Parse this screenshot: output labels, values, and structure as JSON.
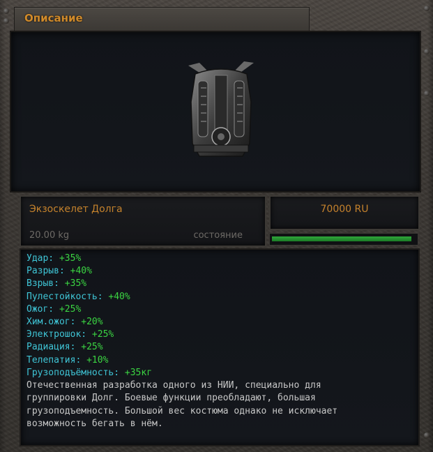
{
  "window": {
    "title": "Описание"
  },
  "item": {
    "image_icon": "exoskeleton-armor-icon",
    "name": "Экзоскелет Долга",
    "weight": "20.00 kg",
    "condition_label": "состояние",
    "price": "70000 RU",
    "condition_fraction": 0.98
  },
  "stats": [
    {
      "label": "Удар:",
      "value": "+35%"
    },
    {
      "label": "Разрыв:",
      "value": "+40%"
    },
    {
      "label": "Взрыв:",
      "value": "+35%"
    },
    {
      "label": "Пулестойкость:",
      "value": "+40%"
    },
    {
      "label": "Ожог:",
      "value": "+25%"
    },
    {
      "label": "Хим.ожог:",
      "value": "+20%"
    },
    {
      "label": "Электрошок:",
      "value": "+25%"
    },
    {
      "label": "Радиация:",
      "value": "+25%"
    },
    {
      "label": "Телепатия:",
      "value": "+10%"
    },
    {
      "label": "Грузоподъёмность:",
      "value": "+35кг"
    }
  ],
  "description_lines": [
    " Отечественная разработка одного из НИИ, специально для",
    "группировки Долг. Боевые функции преобладают, большая",
    "грузоподъемность. Большой вес костюма однако не исключает",
    "возможность бегать в нём."
  ],
  "colors": {
    "title": "#d08a2a",
    "stat_label": "#3fc5d6",
    "stat_value": "#3bd542",
    "condition": "#2fa73a"
  }
}
